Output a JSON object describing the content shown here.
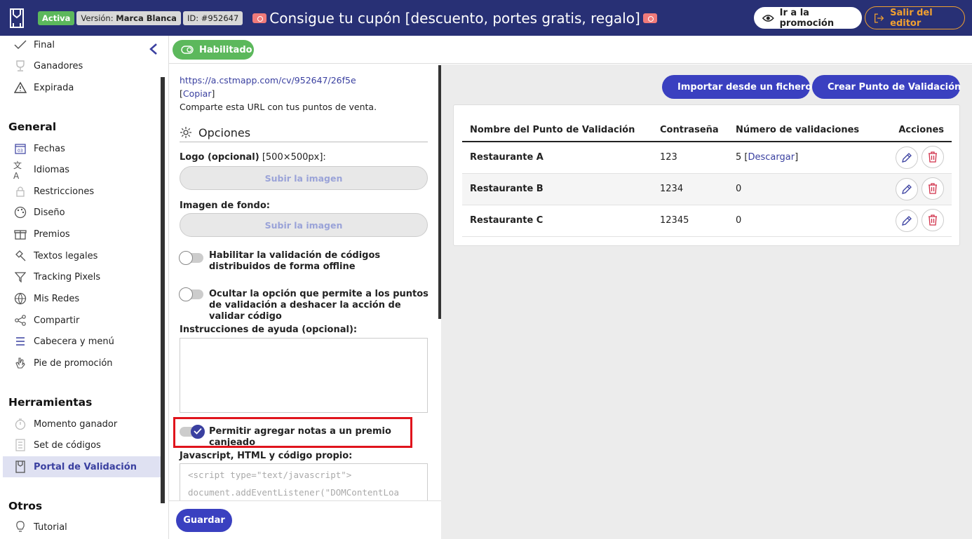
{
  "header": {
    "status_badge": "Activa",
    "version_label": "Versión:",
    "version_value": "Marca Blanca",
    "id_badge": "ID: #952647",
    "title": "Consigue tu cupón [descuento, portes gratis, regalo]",
    "go_promo_label": "Ir a la promoción",
    "exit_label": "Salir del editor"
  },
  "sidebar": {
    "top_items": [
      {
        "label": "Final",
        "icon": "check-icon"
      },
      {
        "label": "Ganadores",
        "icon": "trophy-icon"
      },
      {
        "label": "Expirada",
        "icon": "warning-icon"
      }
    ],
    "section_general": "General",
    "general_items": [
      {
        "label": "Fechas",
        "icon": "calendar-icon"
      },
      {
        "label": "Idiomas",
        "icon": "translate-icon"
      },
      {
        "label": "Restricciones",
        "icon": "lock-icon"
      },
      {
        "label": "Diseño",
        "icon": "palette-icon"
      },
      {
        "label": "Premios",
        "icon": "gift-icon"
      },
      {
        "label": "Textos legales",
        "icon": "gavel-icon"
      },
      {
        "label": "Tracking Pixels",
        "icon": "filter-icon"
      },
      {
        "label": "Mis Redes",
        "icon": "globe-icon"
      },
      {
        "label": "Compartir",
        "icon": "share-icon"
      },
      {
        "label": "Cabecera y menú",
        "icon": "menu-icon"
      },
      {
        "label": "Pie de promoción",
        "icon": "hand-icon"
      }
    ],
    "section_tools": "Herramientas",
    "tools_items": [
      {
        "label": "Momento ganador",
        "icon": "stopwatch-icon"
      },
      {
        "label": "Set de códigos",
        "icon": "codes-icon"
      },
      {
        "label": "Portal de Validación",
        "icon": "portal-icon"
      }
    ],
    "section_others": "Otros",
    "others_items": [
      {
        "label": "Tutorial",
        "icon": "lightbulb-icon"
      }
    ]
  },
  "middle": {
    "enabled_label": "Habilitado",
    "url": "https://a.cstmapp.com/cv/952647/26f5e",
    "copy_open": "[",
    "copy_label": "Copiar",
    "copy_close": "]",
    "share_note": "Comparte esta URL con tus puntos de venta.",
    "options_title": "Opciones",
    "logo_label": "Logo (opcional)",
    "logo_size": "[500×500px]:",
    "upload_label": "Subir la imagen",
    "bg_label": "Imagen de fondo:",
    "toggle_offline": "Habilitar la validación de códigos distribuidos de forma offline",
    "toggle_undo": "Ocultar la opción que permite a los puntos de validación a deshacer la acción de validar código",
    "help_label": "Instrucciones de ayuda (opcional):",
    "toggle_notes": "Permitir agregar notas a un premio canjeado",
    "code_label": "Javascript, HTML y código propio:",
    "code_line1": "<script type=\"text/javascript\">",
    "code_line2": "document.addEventListener(\"DOMContentLoa",
    "save_label": "Guardar"
  },
  "right": {
    "import_label": "Importar desde un fichero",
    "create_label": "Crear Punto de Validación",
    "columns": [
      "Nombre del Punto de Validación",
      "Contraseña",
      "Número de validaciones",
      "Acciones"
    ],
    "rows": [
      {
        "name": "Restaurante A",
        "password": "123",
        "validations": "5",
        "download": "Descargar"
      },
      {
        "name": "Restaurante B",
        "password": "1234",
        "validations": "0"
      },
      {
        "name": "Restaurante C",
        "password": "12345",
        "validations": "0"
      }
    ]
  },
  "colors": {
    "brand": "#283075",
    "accent": "#3a40c0",
    "success": "#5cb85c",
    "warning": "#f0a030",
    "danger": "#e0141c"
  }
}
